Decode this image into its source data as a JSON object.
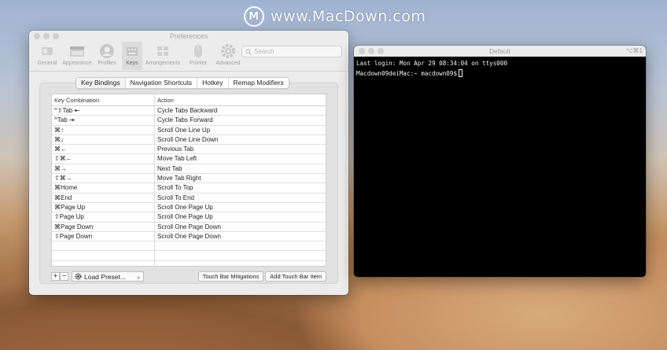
{
  "watermark": {
    "logo_letter": "M",
    "text": "www.MacDown.com"
  },
  "preferences": {
    "title": "Preferences",
    "toolbar": [
      {
        "label": "General",
        "icon": "switch-icon"
      },
      {
        "label": "Appearance",
        "icon": "window-icon"
      },
      {
        "label": "Profiles",
        "icon": "person-icon"
      },
      {
        "label": "Keys",
        "icon": "keyboard-icon",
        "active": true
      },
      {
        "label": "Arrangements",
        "icon": "grid-icon"
      },
      {
        "label": "Pointer",
        "icon": "mouse-icon"
      },
      {
        "label": "Advanced",
        "icon": "gear-icon"
      }
    ],
    "search_placeholder": "Search",
    "tabs": [
      "Key Bindings",
      "Navigation Shortcuts",
      "Hotkey",
      "Remap Modifiers"
    ],
    "table": {
      "headers": [
        "Key Combination",
        "Action"
      ],
      "rows": [
        [
          "^⇧Tab ⇤",
          "Cycle Tabs Backward"
        ],
        [
          "^Tab ⇥",
          "Cycle Tabs Forward"
        ],
        [
          "⌘↑",
          "Scroll One Line Up"
        ],
        [
          "⌘↓",
          "Scroll One Line Down"
        ],
        [
          "⌘←",
          "Previous Tab"
        ],
        [
          "⇧⌘←",
          "Move Tab Left"
        ],
        [
          "⌘→",
          "Next Tab"
        ],
        [
          "⇧⌘→",
          "Move Tab Right"
        ],
        [
          "⌘Home",
          "Scroll To Top"
        ],
        [
          "⌘End",
          "Scroll To End"
        ],
        [
          "⌘Page Up",
          "Scroll One Page Up"
        ],
        [
          "⇧Page Up",
          "Scroll One Page Up"
        ],
        [
          "⌘Page Down",
          "Scroll One Page Down"
        ],
        [
          "⇧Page Down",
          "Scroll One Page Down"
        ]
      ]
    },
    "add_button": "+",
    "remove_button": "−",
    "load_preset": "Load Preset...",
    "touch_bar_mitigations": "Touch Bar Mitigations",
    "add_touch_bar_item": "Add Touch Bar Item"
  },
  "terminal": {
    "title": "Default",
    "shortcut": "⌥⌘1",
    "line1": "Last login: Mon Apr 29 08:34:04 on ttys000",
    "prompt": "Macdown09deiMac:~ macdown09$"
  }
}
